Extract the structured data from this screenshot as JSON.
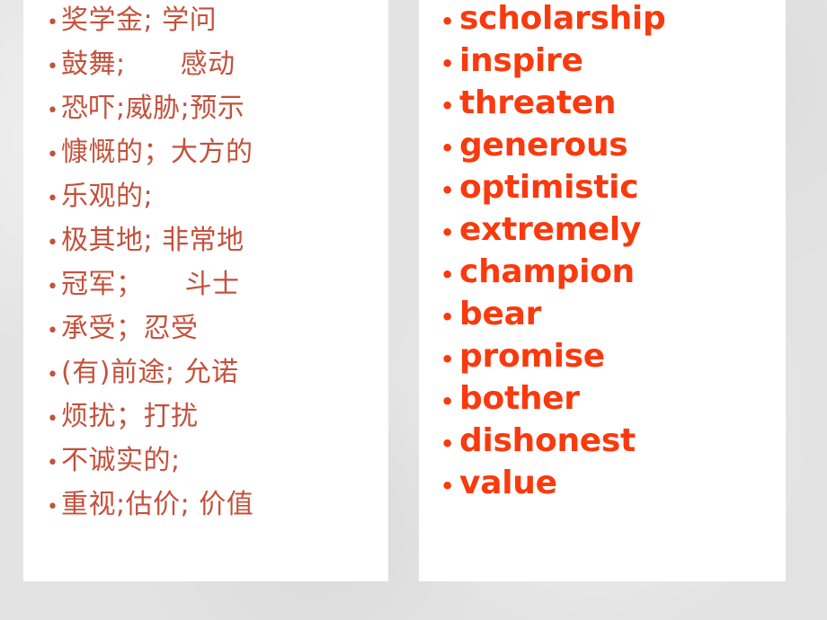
{
  "slide": {
    "background_color": "#e3e3e3",
    "panel_color": "#ffffff",
    "left_text_color": "#c4513c",
    "right_text_color": "#f93a0e",
    "bullet_glyph": "•"
  },
  "left_column": {
    "name": "chinese-definitions",
    "items": [
      {
        "text": "奖学金; 学问"
      },
      {
        "text": "鼓舞;　　感动"
      },
      {
        "text": "恐吓;威胁;预示"
      },
      {
        "text": "慷慨的；大方的"
      },
      {
        "text": "乐观的;"
      },
      {
        "text": "极其地; 非常地"
      },
      {
        "text": "冠军；　　斗士"
      },
      {
        "text": "承受；忍受"
      },
      {
        "text": "(有)前途; 允诺"
      },
      {
        "text": "烦扰；打扰"
      },
      {
        "text": "不诚实的;"
      },
      {
        "text": "重视;估价; 价值"
      }
    ]
  },
  "right_column": {
    "name": "english-words",
    "items": [
      {
        "text": "scholarship"
      },
      {
        "text": "inspire"
      },
      {
        "text": "threaten"
      },
      {
        "text": "generous"
      },
      {
        "text": "optimistic"
      },
      {
        "text": "extremely"
      },
      {
        "text": "champion"
      },
      {
        "text": "bear"
      },
      {
        "text": "promise"
      },
      {
        "text": "bother"
      },
      {
        "text": "dishonest"
      },
      {
        "text": "value"
      }
    ]
  }
}
